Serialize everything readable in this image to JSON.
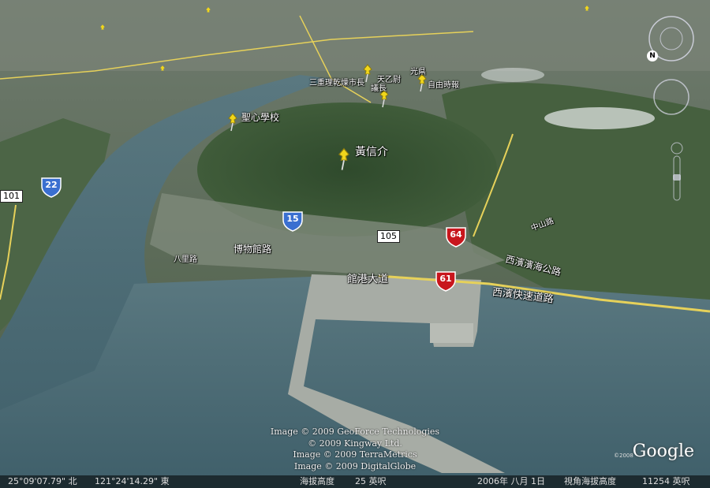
{
  "pins": [
    {
      "name": "pin-sacred-heart-school",
      "label": "聖心學校"
    },
    {
      "name": "pin-huang-xin-jie",
      "label": "黃信介"
    },
    {
      "name": "pin-liberty-times",
      "label": "自由時報"
    },
    {
      "name": "pin-guangyi",
      "label": "光県"
    },
    {
      "name": "pin-yilang",
      "label": "議長"
    },
    {
      "name": "pin-tianyi",
      "label": "天乙尉"
    },
    {
      "name": "pin-sanchong-city",
      "label": "三重理乾燥市長"
    }
  ],
  "shields": [
    {
      "name": "shield-22",
      "number": "22",
      "color": "#3a6fd0"
    },
    {
      "name": "shield-15",
      "number": "15",
      "color": "#3a6fd0"
    },
    {
      "name": "shield-64",
      "number": "64",
      "color": "#c8161d"
    },
    {
      "name": "shield-61",
      "number": "61",
      "color": "#c8161d"
    }
  ],
  "highway_boxes": [
    {
      "name": "hw-105",
      "number": "105"
    },
    {
      "name": "hw-101",
      "number": "101"
    }
  ],
  "roads": [
    {
      "name": "road-guangang-avenue",
      "label": "館港大道"
    },
    {
      "name": "road-museum-road",
      "label": "博物館路"
    },
    {
      "name": "road-west-coast-expressway",
      "label": "西濱快速道路"
    },
    {
      "name": "road-west-coast-highway",
      "label": "西濱濱海公路"
    },
    {
      "name": "road-zhongshan-road",
      "label": "中山路"
    },
    {
      "name": "road-small",
      "label": "八里路"
    }
  ],
  "credits": [
    "Image © 2009 GeoForce Technologies",
    "© 2009 Kingway Ltd.",
    "Image © 2009 TerraMetrics",
    "Image © 2009 DigitalGlobe"
  ],
  "logo": "Google",
  "logo_copyright": "©2008",
  "status": {
    "lat": "25°09'07.79\" 北",
    "lon": "121°24'14.29\" 東",
    "elev_label": "海拔高度",
    "elev_value": "25 英呎",
    "date": "2006年 八月 1日",
    "eye_label": "視角海拔高度",
    "eye_value": "11254 英呎"
  },
  "nav": {
    "north": "N"
  },
  "colors": {
    "sea": "#4f6f7a",
    "river": "#5e7f88",
    "land": "#3f5a3a",
    "pin": "#f1d61b",
    "road": "#e6d15a"
  }
}
